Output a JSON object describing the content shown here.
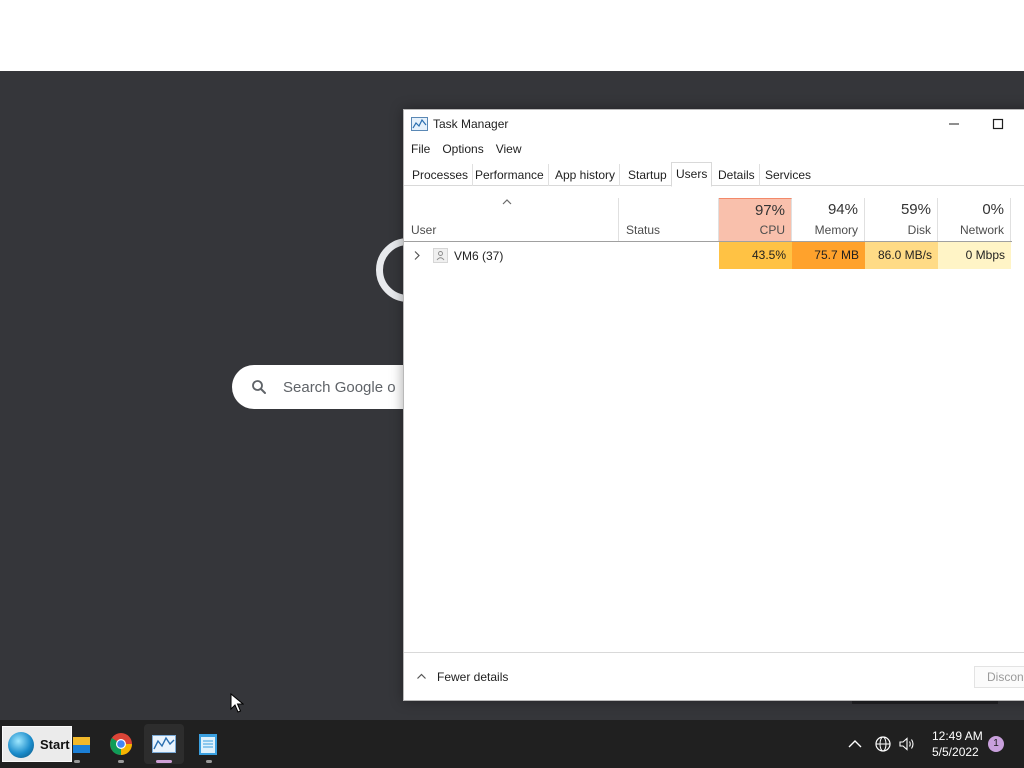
{
  "browser": {
    "search_placeholder": "Search Google o"
  },
  "task_manager": {
    "title": "Task Manager",
    "menu": [
      "File",
      "Options",
      "View"
    ],
    "tabs": [
      "Processes",
      "Performance",
      "App history",
      "Startup",
      "Users",
      "Details",
      "Services"
    ],
    "active_tab": "Users",
    "columns": {
      "user": "User",
      "status": "Status",
      "cpu": {
        "percent": "97%",
        "label": "CPU"
      },
      "memory": {
        "percent": "94%",
        "label": "Memory"
      },
      "disk": {
        "percent": "59%",
        "label": "Disk"
      },
      "network": {
        "percent": "0%",
        "label": "Network"
      }
    },
    "rows": [
      {
        "user": "VM6 (37)",
        "status": "",
        "cpu": "43.5%",
        "memory": "75.7 MB",
        "disk": "86.0 MB/s",
        "network": "0 Mbps"
      }
    ],
    "footer": {
      "fewer_details": "Fewer details",
      "disconnect": "Discon"
    },
    "colors": {
      "cpu_header": "#f9c0ac",
      "cpu_cell": "#ffc244",
      "memory_cell": "#ffa22c",
      "disk_cell": "#ffdb86",
      "network_cell": "#fff4c6"
    }
  },
  "taskbar": {
    "start_label": "Start",
    "apps": [
      "file-explorer-icon",
      "chrome-icon",
      "task-manager-icon",
      "notepad-icon"
    ],
    "clock_time": "12:49 AM",
    "clock_date": "5/5/2022",
    "notification_count": "1"
  }
}
